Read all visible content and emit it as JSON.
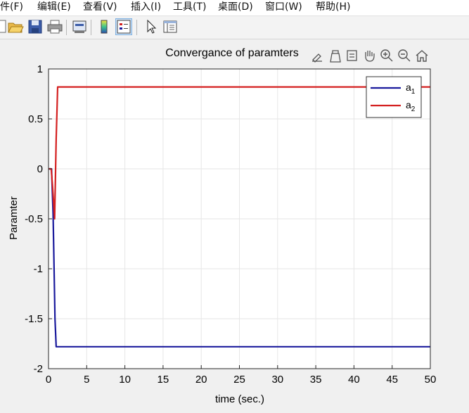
{
  "menu": {
    "items": [
      "文件(F)",
      "编辑(E)",
      "查看(V)",
      "插入(I)",
      "工具(T)",
      "桌面(D)",
      "窗口(W)",
      "帮助(H)"
    ]
  },
  "toolbar": {
    "buttons": [
      "new-figure-icon",
      "open-folder-icon",
      "save-icon",
      "print-icon",
      "print-preview-icon",
      "colorbar-icon",
      "legend-icon",
      "pointer-icon",
      "property-editor-icon"
    ]
  },
  "axes_toolbar": {
    "buttons": [
      "brush-icon",
      "data-tips-icon",
      "rotate-icon",
      "pan-icon",
      "zoom-in-icon",
      "zoom-out-icon",
      "home-icon"
    ]
  },
  "colors": {
    "series_a1": "#1a1a9c",
    "series_a2": "#d42020",
    "grid": "#e6e6e6",
    "axes_bg": "#ffffff",
    "figure_bg": "#f0f0f0"
  },
  "chart_data": {
    "type": "line",
    "title": "Convergance of paramters",
    "xlabel": "time (sec.)",
    "ylabel": "Paramter",
    "xlim": [
      0,
      50
    ],
    "ylim": [
      -2,
      1
    ],
    "xticks": [
      0,
      5,
      10,
      15,
      20,
      25,
      30,
      35,
      40,
      45,
      50
    ],
    "yticks": [
      -2,
      -1.5,
      -1,
      -0.5,
      0,
      0.5,
      1
    ],
    "ytick_labels": [
      "-2",
      "-1.5",
      "-1",
      "-0.5",
      "0",
      "0.5",
      "1"
    ],
    "grid": true,
    "legend_location": "top-right",
    "series": [
      {
        "name": "a",
        "subscript": "1",
        "x": [
          0,
          0.4,
          0.6,
          0.85,
          1.0,
          3,
          10,
          20,
          30,
          40,
          50
        ],
        "y": [
          0,
          0,
          -0.45,
          -1.5,
          -1.78,
          -1.78,
          -1.78,
          -1.78,
          -1.78,
          -1.78,
          -1.78
        ]
      },
      {
        "name": "a",
        "subscript": "2",
        "x": [
          0,
          0.35,
          0.55,
          0.8,
          1.0,
          1.2,
          3,
          10,
          20,
          30,
          40,
          50
        ],
        "y": [
          0,
          0,
          -0.2,
          -0.5,
          0.3,
          0.82,
          0.82,
          0.82,
          0.82,
          0.82,
          0.82,
          0.82
        ]
      }
    ]
  }
}
